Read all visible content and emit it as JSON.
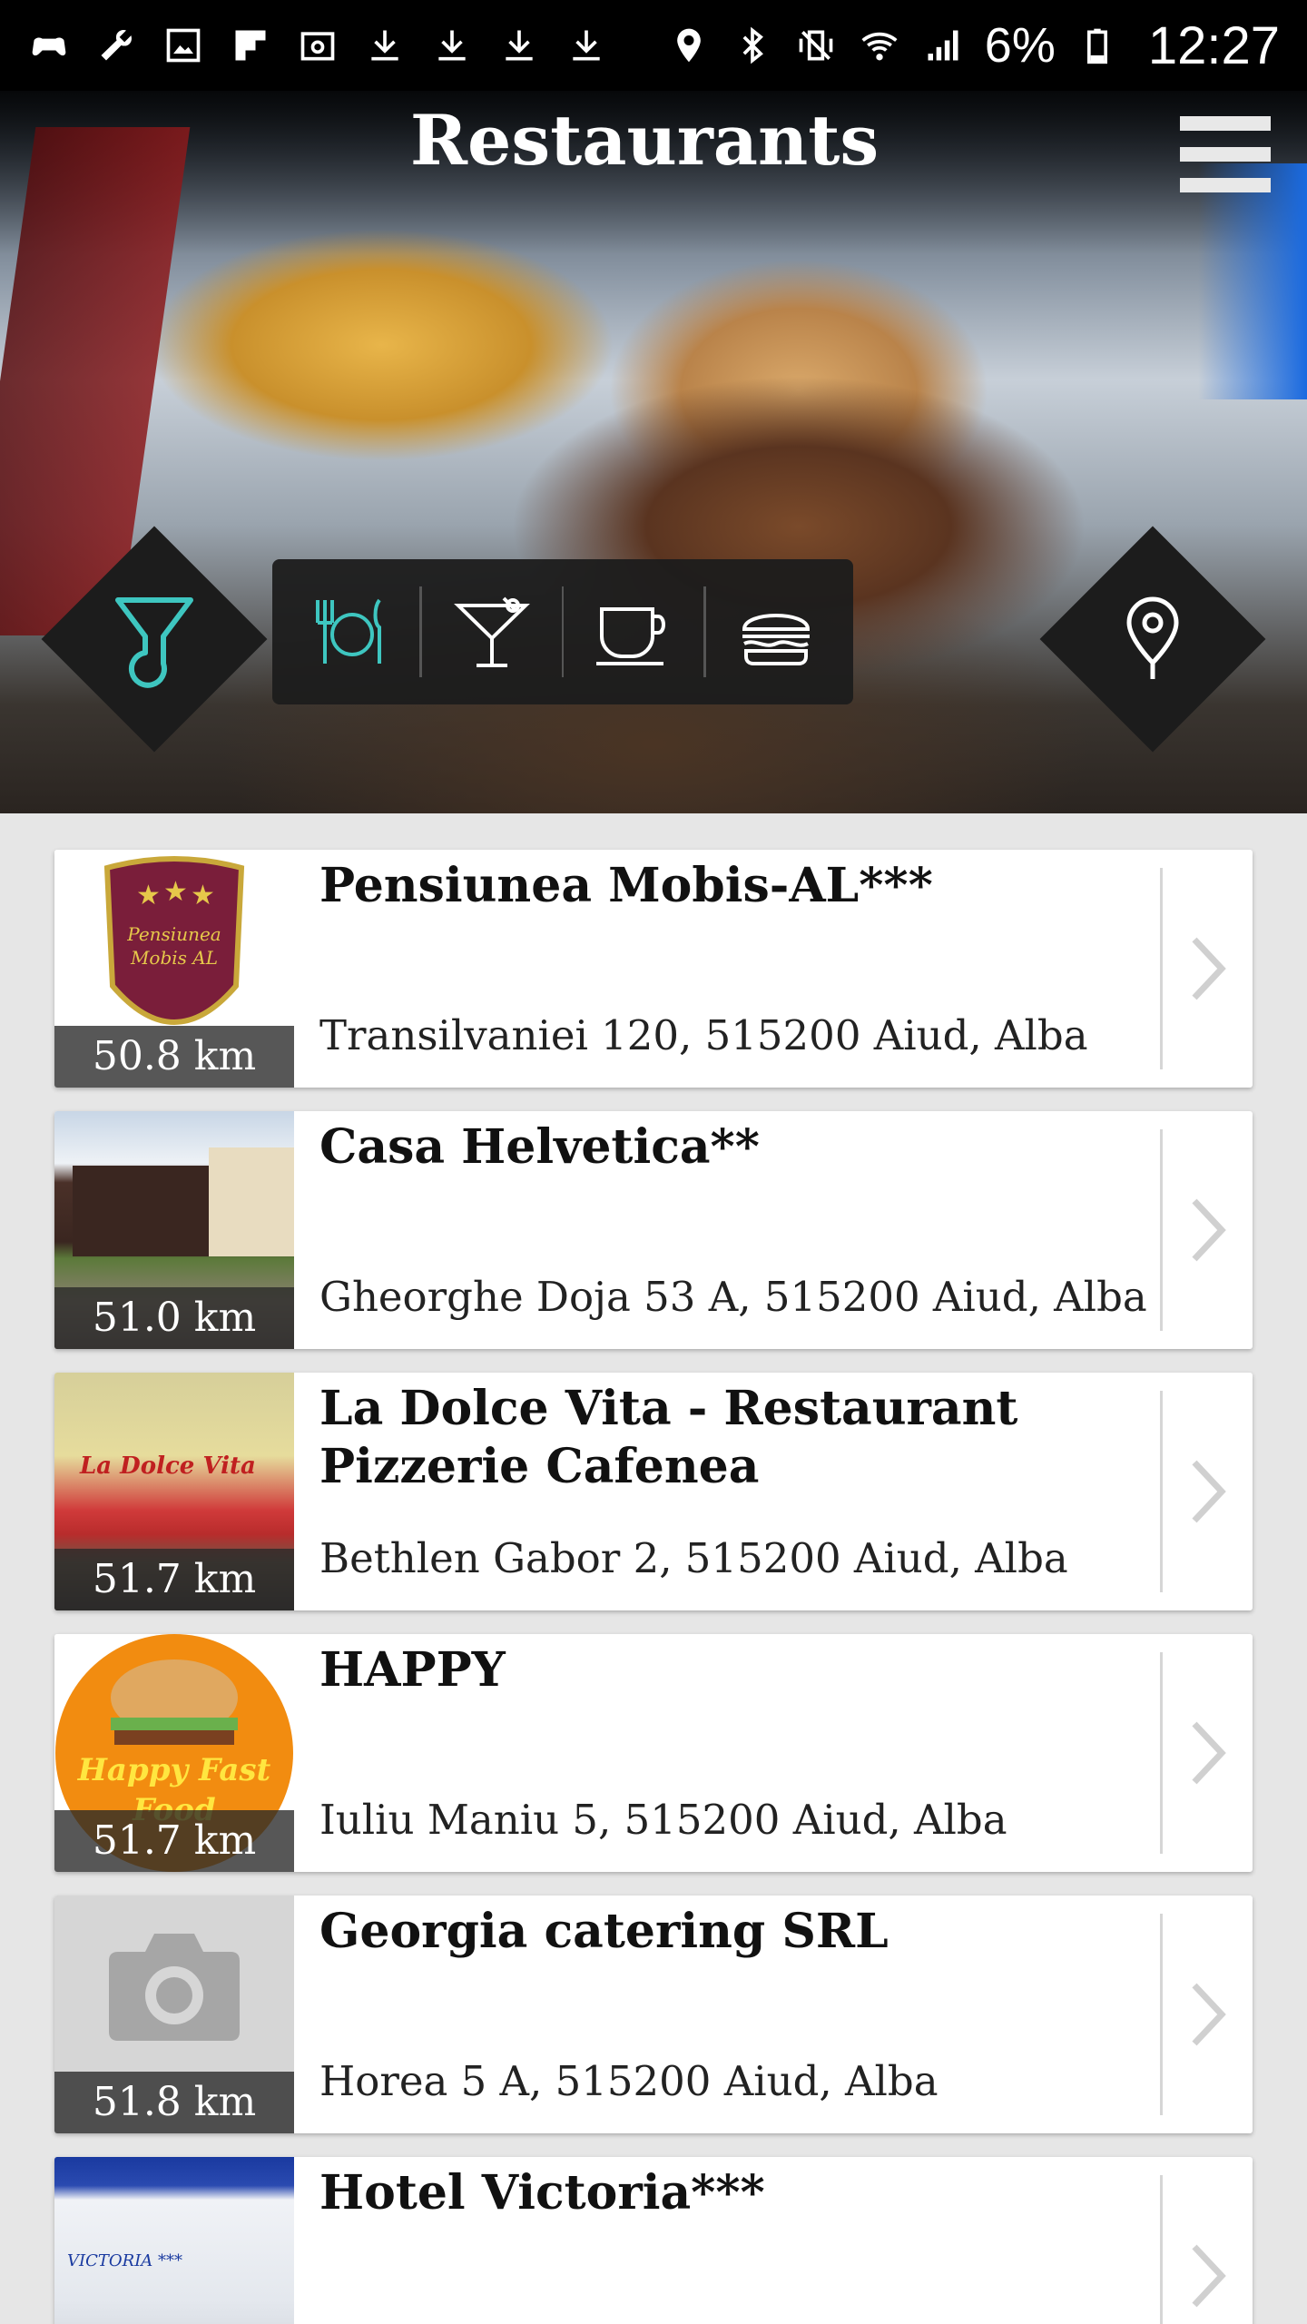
{
  "status_bar": {
    "battery": "6%",
    "time": "12:27",
    "left_icons": [
      "game-controller-icon",
      "wrench-icon",
      "image-icon",
      "flipboard-icon",
      "email-icon",
      "download-icon",
      "download-icon",
      "download-icon",
      "download-icon"
    ],
    "right_icons": [
      "location-icon",
      "bluetooth-icon",
      "vibrate-icon",
      "wifi-icon",
      "signal-icon",
      "battery-icon"
    ]
  },
  "header": {
    "title": "Restaurants"
  },
  "filters": {
    "left_button": "filter-icon",
    "right_button": "location-pin-icon",
    "categories": [
      {
        "icon": "cutlery-icon",
        "active": true
      },
      {
        "icon": "cocktail-icon",
        "active": false
      },
      {
        "icon": "coffee-cup-icon",
        "active": false
      },
      {
        "icon": "burger-icon",
        "active": false
      }
    ],
    "active_color": "#3ec6c0"
  },
  "restaurants": [
    {
      "name": "Pensiunea Mobis-AL***",
      "address": "Transilvaniei 120, 515200 Aiud, Alba",
      "distance": "50.8 km",
      "logo_text": "Pensiunea Mobis AL"
    },
    {
      "name": "Casa Helvetica**",
      "address": "Gheorghe Doja 53 A, 515200 Aiud, Alba",
      "distance": "51.0 km"
    },
    {
      "name": "La Dolce Vita - Restaurant Pizzerie Cafenea",
      "address": "Bethlen Gabor 2, 515200 Aiud, Alba",
      "distance": "51.7 km",
      "logo_text": "La Dolce Vita"
    },
    {
      "name": "HAPPY",
      "address": "Iuliu Maniu 5, 515200 Aiud, Alba",
      "distance": "51.7 km",
      "logo_text": "Happy Fast Food"
    },
    {
      "name": "Georgia catering SRL",
      "address": "Horea 5 A, 515200 Aiud, Alba",
      "distance": "51.8 km"
    },
    {
      "name": "Hotel Victoria***",
      "address": "",
      "distance": "",
      "logo_text": "VICTORIA ***"
    }
  ]
}
